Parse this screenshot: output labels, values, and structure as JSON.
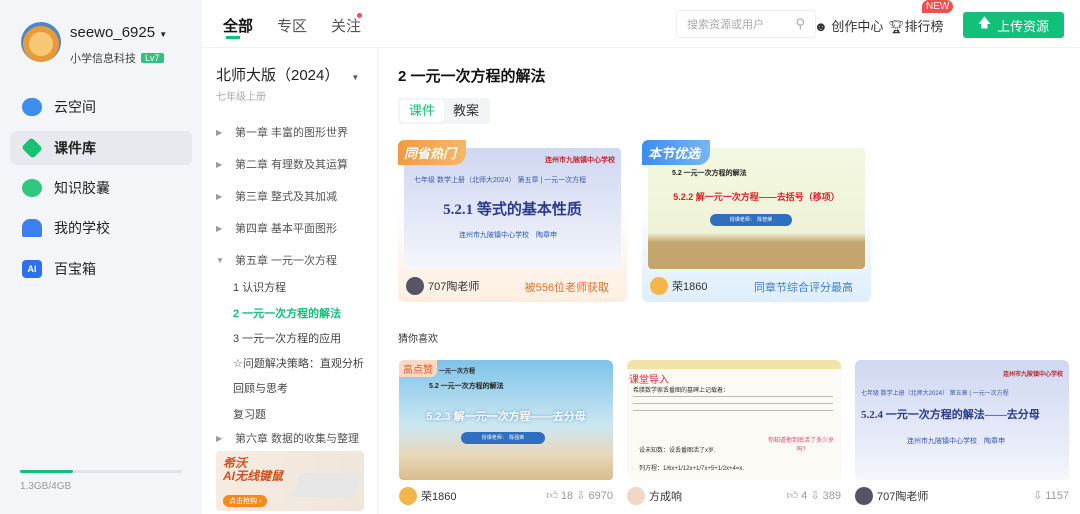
{
  "user": {
    "name": "seewo_6925",
    "org": "小学信息科技",
    "level": "Lv7"
  },
  "sidebar": {
    "items": [
      {
        "label": "云空间",
        "icon": "cloud-icon"
      },
      {
        "label": "课件库",
        "icon": "courseware-icon",
        "active": true
      },
      {
        "label": "知识胶囊",
        "icon": "capsule-icon"
      },
      {
        "label": "我的学校",
        "icon": "school-icon"
      },
      {
        "label": "百宝箱",
        "icon": "ai-toolbox-icon",
        "icon_text": "AI"
      }
    ],
    "storage": {
      "text": "1.3GB/4GB",
      "fraction": 0.325
    }
  },
  "topbar": {
    "tabs": [
      "全部",
      "专区",
      "关注"
    ],
    "search_placeholder": "搜索资源或用户",
    "creator": "创作中心",
    "ranking": "排行榜",
    "new_badge": "NEW",
    "upload": "上传资源"
  },
  "catalog": {
    "edition": "北师大版（2024）",
    "grade": "七年级上册",
    "chapters": [
      "第一章 丰富的图形世界",
      "第二章 有理数及其运算",
      "第三章 整式及其加减",
      "第四章 基本平面图形",
      "第五章 一元一次方程"
    ],
    "sections": [
      "1 认识方程",
      "2 一元一次方程的解法",
      "3 一元一次方程的应用",
      "☆问题解决策略：直观分析",
      "回顾与思考",
      "复习题"
    ],
    "next_chapter": "第六章 数据的收集与整理",
    "ad": {
      "title1": "希沃",
      "title2": "AI无线键鼠",
      "button": "点击抢购 ›"
    }
  },
  "main": {
    "title": "2 一元一次方程的解法",
    "tabs": [
      "课件",
      "教案"
    ],
    "featured": [
      {
        "tag": "同省热门",
        "school": "连州市九陂镇中心学校",
        "subtitle": "七年级 数学上册（北师大2024） 第五章 | 一元一次方程",
        "heading": "5.2.1 等式的基本性质",
        "author_line": "连州市九陂镇中心学校　陶章申",
        "user": "707陶老师",
        "note": "被556位老师获取"
      },
      {
        "tag": "本节优选",
        "line1": "5.2 一元一次方程的解法",
        "heading": "5.2.2 解一元一次方程——去括号（移项）",
        "teacher": "授课老师：　陈管荣",
        "user": "荣1860",
        "note": "同章节综合评分最高"
      }
    ],
    "guess_title": "猜你喜欢",
    "recommend": [
      {
        "tag": "高点赞",
        "line0": "一元一次方程",
        "line1": "5.2 一元一次方程的解法",
        "heading": "5.2.3 解一元一次方程——去分母",
        "teacher": "授课老师：　陈强荣",
        "user": "荣1860",
        "likes": "18",
        "downloads": "6970"
      },
      {
        "heading": "课堂导入",
        "body": "希腊数学家丢番图的墓碑上记载着：",
        "q1": "设未知数：设丢番图活了x岁.",
        "q2": "列方程：1/6x+1/12x+1/7x+5+1/2x+4=x.",
        "bubble": "你知道他到底活了多少岁吗?",
        "user": "方成响",
        "likes": "4",
        "downloads": "389"
      },
      {
        "school": "连州市九陂镇中心学校",
        "subtitle": "七年级 数学上册（北师大2024） 第五章 | 一元一次方程",
        "heading": "5.2.4 一元一次方程的解法——去分母",
        "author_line": "连州市九陂镇中心学校　陶章申",
        "user": "707陶老师",
        "downloads": "1157"
      }
    ]
  },
  "colors": {
    "accent": "#12c07a",
    "new": "#f0504a"
  }
}
